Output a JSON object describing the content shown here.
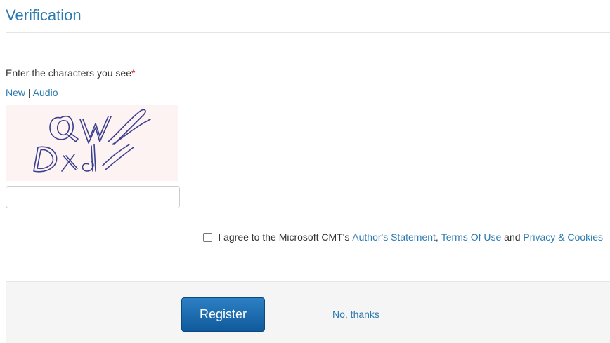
{
  "verification": {
    "title": "Verification"
  },
  "captcha": {
    "label": "Enter the characters you see",
    "required_marker": "*",
    "new_link": "New",
    "separator": " | ",
    "audio_link": "Audio",
    "image_alt": "QW DXd",
    "input_value": "",
    "input_placeholder": ""
  },
  "agreement": {
    "checked": false,
    "prefix": "I agree to the Microsoft CMT's ",
    "authors_statement": "Author's Statement",
    "comma": ", ",
    "terms_of_use": "Terms Of Use",
    "and": " and ",
    "privacy_cookies": "Privacy & Cookies"
  },
  "footer": {
    "register_label": "Register",
    "no_thanks_label": "No, thanks"
  },
  "colors": {
    "link": "#2a7ab0",
    "heading": "#2a7ab0",
    "required": "#c9302c",
    "button_top": "#2d7fc4",
    "button_bottom": "#0f5a9c",
    "footer_bg": "#f5f5f5"
  }
}
